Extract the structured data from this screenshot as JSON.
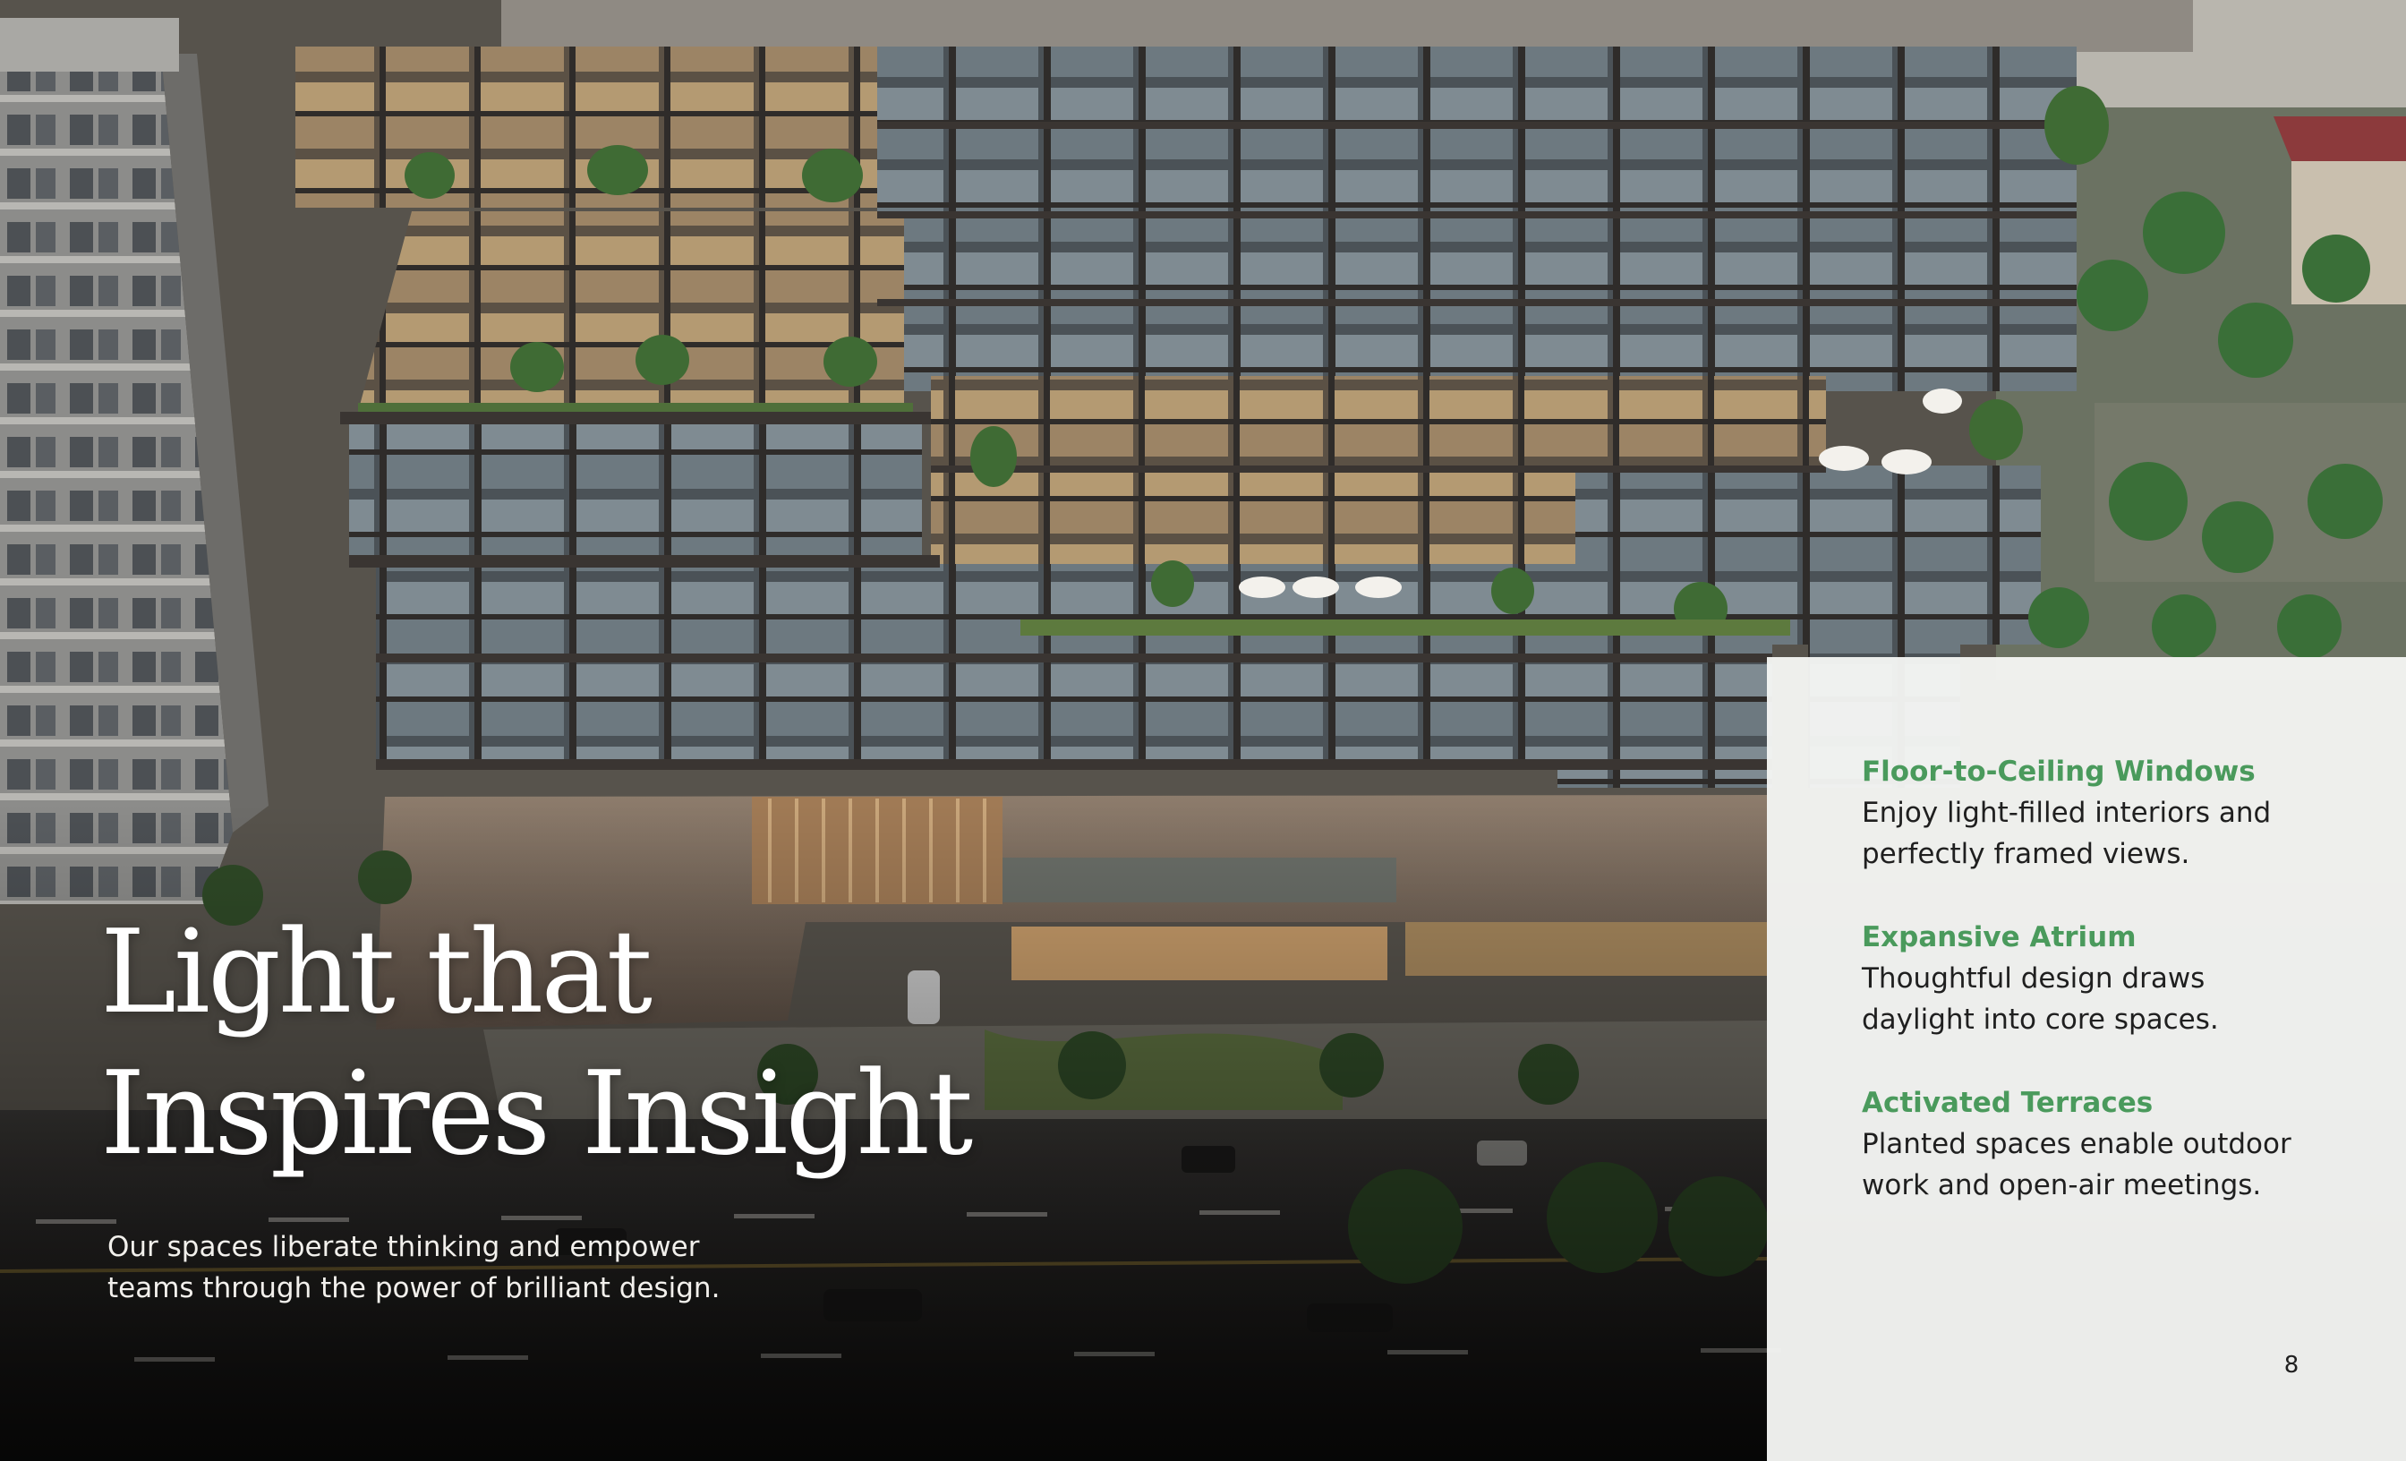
{
  "hero": {
    "title_line1": "Light that",
    "title_line2": "Inspires Insight",
    "subtitle_line1": "Our spaces liberate thinking and empower",
    "subtitle_line2": "teams through the power of brilliant design."
  },
  "features": [
    {
      "title": "Floor-to-Ceiling Windows",
      "line1": "Enjoy light-filled interiors and",
      "line2": "perfectly framed views."
    },
    {
      "title": "Expansive Atrium",
      "line1": "Thoughtful design draws",
      "line2": "daylight into core spaces."
    },
    {
      "title": "Activated Terraces",
      "line1": "Planted spaces enable outdoor",
      "line2": "work and open-air meetings."
    }
  ],
  "page_number": "8",
  "colors": {
    "accent_green": "#4a9a5c",
    "panel_background": "#f4f5f3",
    "heading_white": "#ffffff"
  }
}
